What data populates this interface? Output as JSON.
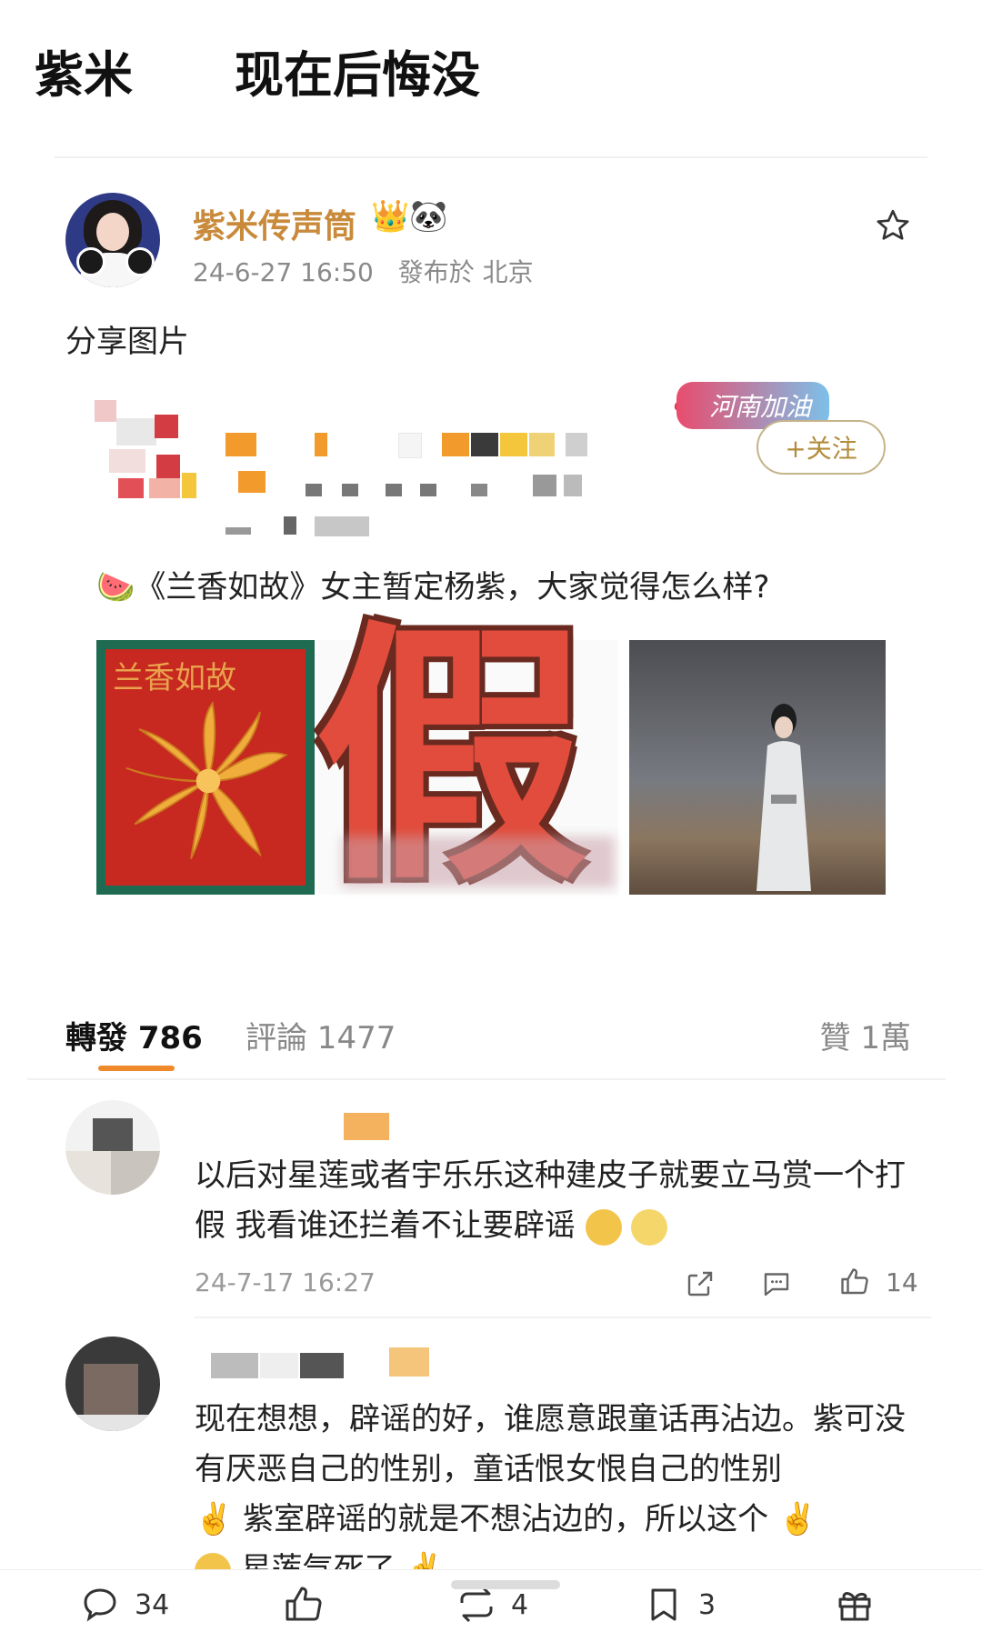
{
  "header": {
    "left_title": "紫米",
    "right_title": "现在后悔没"
  },
  "post": {
    "username": "紫米传声筒",
    "badges": "👑🐼",
    "timestamp": "24-6-27 16:50",
    "location": "發布於 北京",
    "text": "分享图片",
    "embedded": {
      "tag": "河南加油",
      "follow_label": "+关注",
      "headline": "🍉《兰香如故》女主暂定杨紫，大家觉得怎么样?",
      "poster_title": "兰香如故",
      "stamp_text": "假"
    }
  },
  "tabs": {
    "reposts": "轉發 786",
    "comments": "評論 1477",
    "likes": "贊 1萬"
  },
  "comments": [
    {
      "text": "以后对星莲或者宇乐乐这种建皮子就要立马赏一个打假 我看谁还拦着不让要辟谣",
      "time": "24-7-17 16:27",
      "likes": "14"
    },
    {
      "text": "现在想想，辟谣的好，谁愿意跟童话再沾边。紫可没有厌恶自己的性别，童话恨女恨自己的性别",
      "text2": "紫室辟谣的就是不想沾边的，所以这个",
      "text3": "星莲气死了"
    }
  ],
  "bottom_bar": {
    "comment_count": "34",
    "repost_count": "4",
    "bookmark_count": "3"
  },
  "colors": {
    "accent": "#ef8a2c",
    "username": "#c98a3b",
    "stamp": "#e24c3c"
  }
}
